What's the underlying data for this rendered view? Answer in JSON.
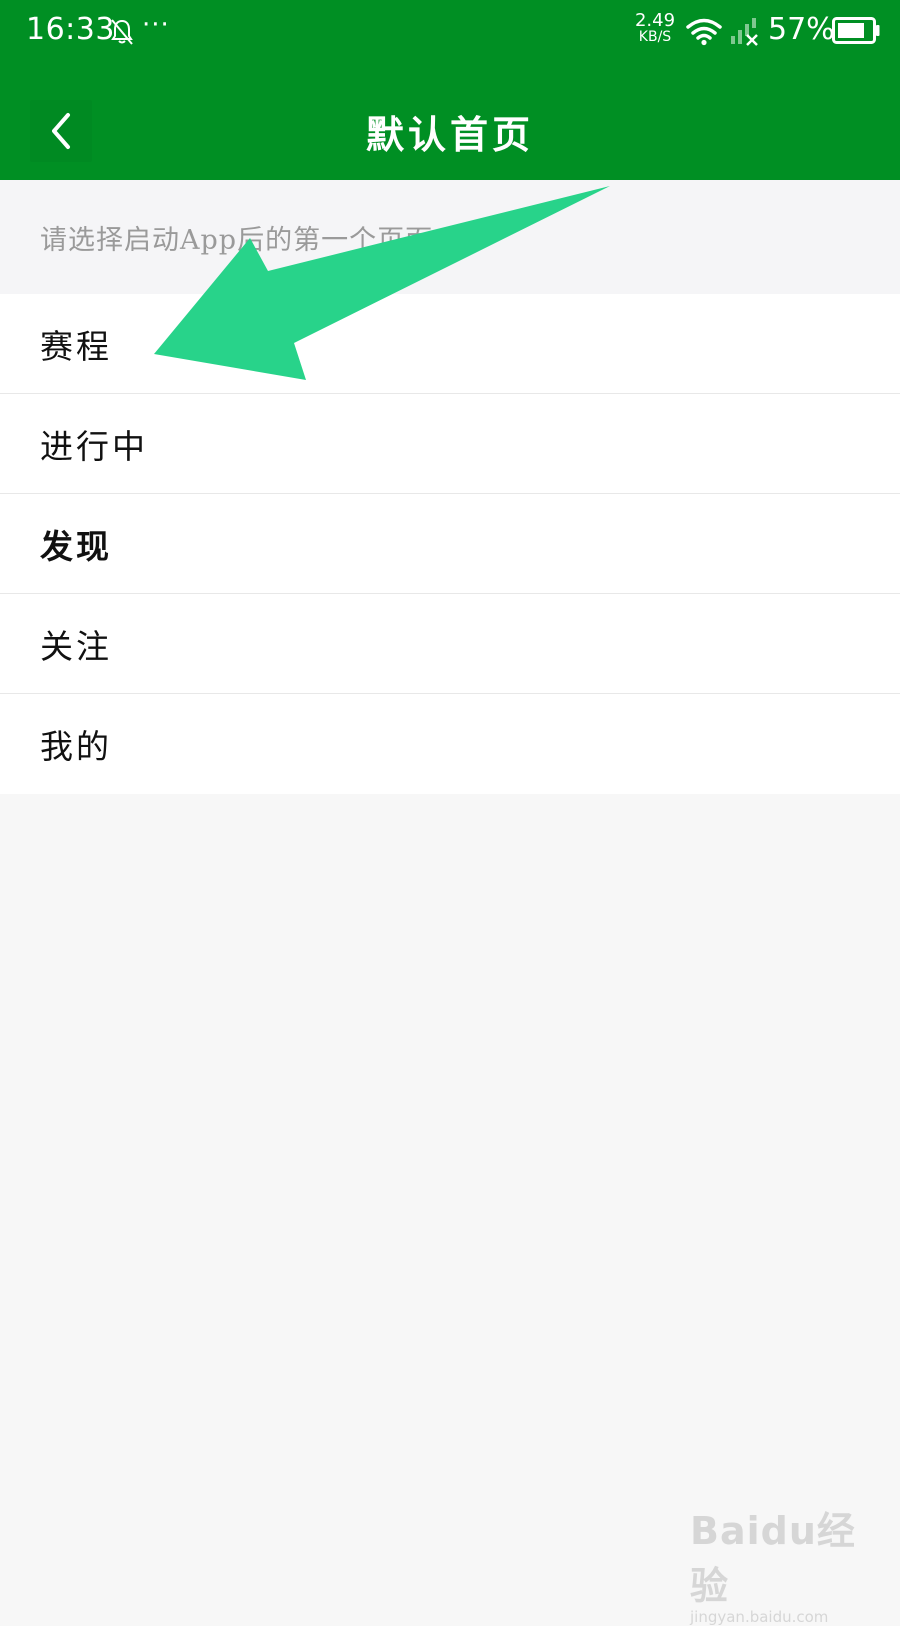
{
  "status_bar": {
    "time": "16:33",
    "more_dots": "···",
    "net_speed_value": "2.49",
    "net_speed_unit": "KB/S",
    "battery_percent": "57%"
  },
  "app_bar": {
    "title": "默认首页",
    "color": "#008f23"
  },
  "hint": "请选择启动App后的第一个页面",
  "options": [
    {
      "label": "赛程",
      "selected": false
    },
    {
      "label": "进行中",
      "selected": false
    },
    {
      "label": "发现",
      "selected": true
    },
    {
      "label": "关注",
      "selected": false
    },
    {
      "label": "我的",
      "selected": false
    }
  ],
  "annotation": {
    "arrow_color": "#28d38a"
  },
  "watermark": {
    "logo": "Baidu经验",
    "url": "jingyan.baidu.com"
  }
}
